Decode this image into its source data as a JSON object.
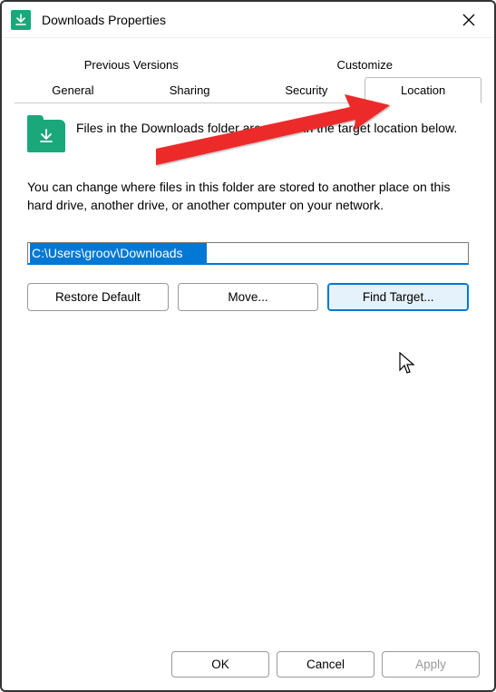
{
  "title": "Downloads Properties",
  "tabs": {
    "row1": [
      "Previous Versions",
      "Customize"
    ],
    "row2": [
      "General",
      "Sharing",
      "Security",
      "Location"
    ],
    "active": "Location"
  },
  "location": {
    "info": "Files in the Downloads folder are stored in the target location below.",
    "explain": "You can change where files in this folder are stored to another place on this hard drive, another drive, or another computer on your network.",
    "path": "C:\\Users\\groov\\Downloads",
    "buttons": {
      "restore": "Restore Default",
      "move": "Move...",
      "find": "Find Target..."
    }
  },
  "footer": {
    "ok": "OK",
    "cancel": "Cancel",
    "apply": "Apply"
  },
  "colors": {
    "accent": "#0078d4",
    "brand": "#1aa87a",
    "arrow": "#ec2a2a"
  }
}
